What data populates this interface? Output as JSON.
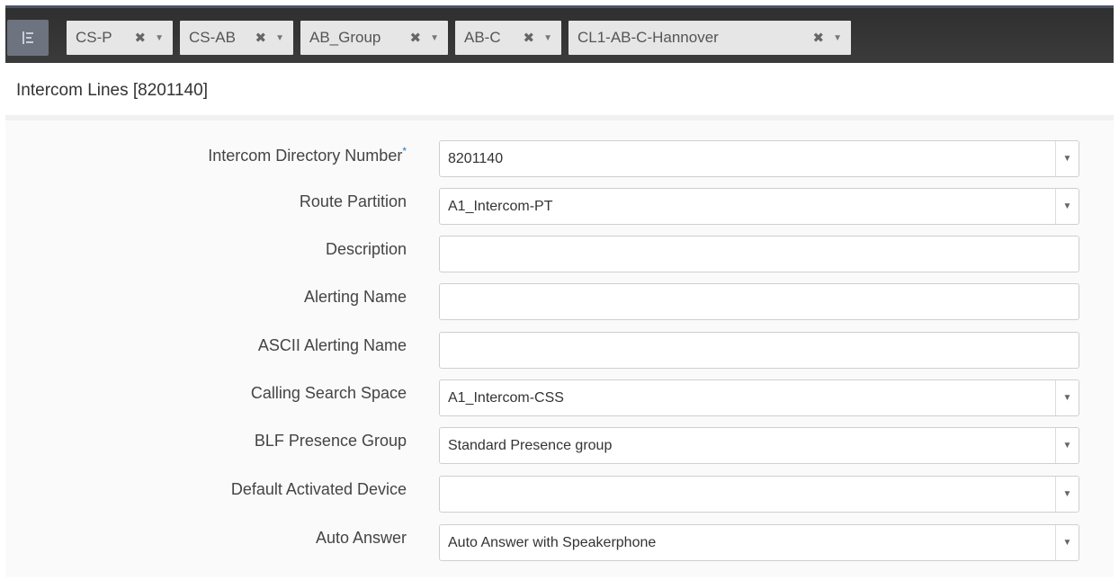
{
  "topbar": {
    "menu_icon": "list-icon",
    "chips": [
      {
        "label": "CS-P"
      },
      {
        "label": "CS-AB"
      },
      {
        "label": "AB_Group"
      },
      {
        "label": "AB-C"
      },
      {
        "label": "CL1-AB-C-Hannover"
      }
    ],
    "close_glyph": "✖",
    "caret_glyph": "▼"
  },
  "page": {
    "title": "Intercom Lines [8201140]"
  },
  "form": {
    "required_mark": "*",
    "dropdown_glyph": "▼",
    "fields": [
      {
        "label": "Intercom Directory Number",
        "value": "8201140"
      },
      {
        "label": "Route Partition",
        "value": "A1_Intercom-PT"
      },
      {
        "label": "Description",
        "value": ""
      },
      {
        "label": "Alerting Name",
        "value": ""
      },
      {
        "label": "ASCII Alerting Name",
        "value": ""
      },
      {
        "label": "Calling Search Space",
        "value": "A1_Intercom-CSS"
      },
      {
        "label": "BLF Presence Group",
        "value": "Standard Presence group"
      },
      {
        "label": "Default Activated Device",
        "value": ""
      },
      {
        "label": "Auto Answer",
        "value": "Auto Answer with Speakerphone"
      }
    ]
  },
  "colors": {
    "topbar": "#333333",
    "chip": "#e6e6e6",
    "required": "#2a7ab8"
  }
}
